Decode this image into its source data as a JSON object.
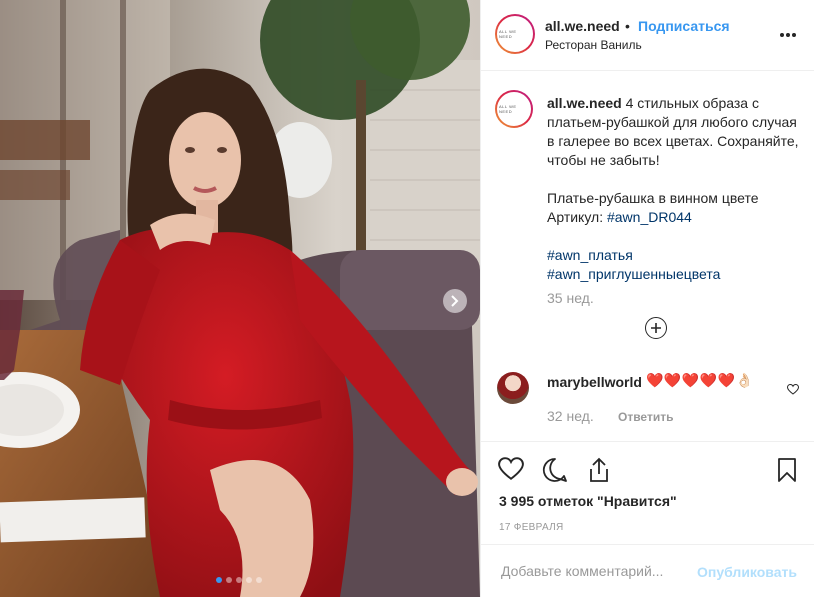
{
  "photo": {
    "description_icon": "fashion-photo",
    "carousel_dots": 5,
    "active_dot": 0
  },
  "header": {
    "avatar_text": "ALL WE NEED",
    "username": "all.we.need",
    "bullet": "•",
    "follow_label": "Подписаться",
    "location": "Ресторан Ваниль",
    "more_icon": "more-icon"
  },
  "caption": {
    "username": "all.we.need",
    "line1": "4 стильных образа с платьем-рубашкой для любого случая в галерее во всех цветах. Сохраняйте, чтобы не забыть!",
    "line2": "Платье-рубашка в винном цвете",
    "article_label": "Артикул:",
    "article_tag": "#awn_DR044",
    "tag1": "#awn_платья",
    "tag2": "#awn_приглушенныецвета",
    "time": "35 нед."
  },
  "comment": {
    "username": "marybellworld",
    "text": "❤️❤️❤️❤️❤️👌🏻",
    "time": "32 нед.",
    "reply_label": "Ответить"
  },
  "actions": {
    "likes": "3 995 отметок \"Нравится\"",
    "date": "17 ФЕВРАЛЯ"
  },
  "add_comment": {
    "placeholder": "Добавьте комментарий...",
    "publish_label": "Опубликовать"
  },
  "colors": {
    "accent": "#3897f0",
    "hashtag": "#003569",
    "muted": "#999999",
    "dress": "#b5141c"
  }
}
